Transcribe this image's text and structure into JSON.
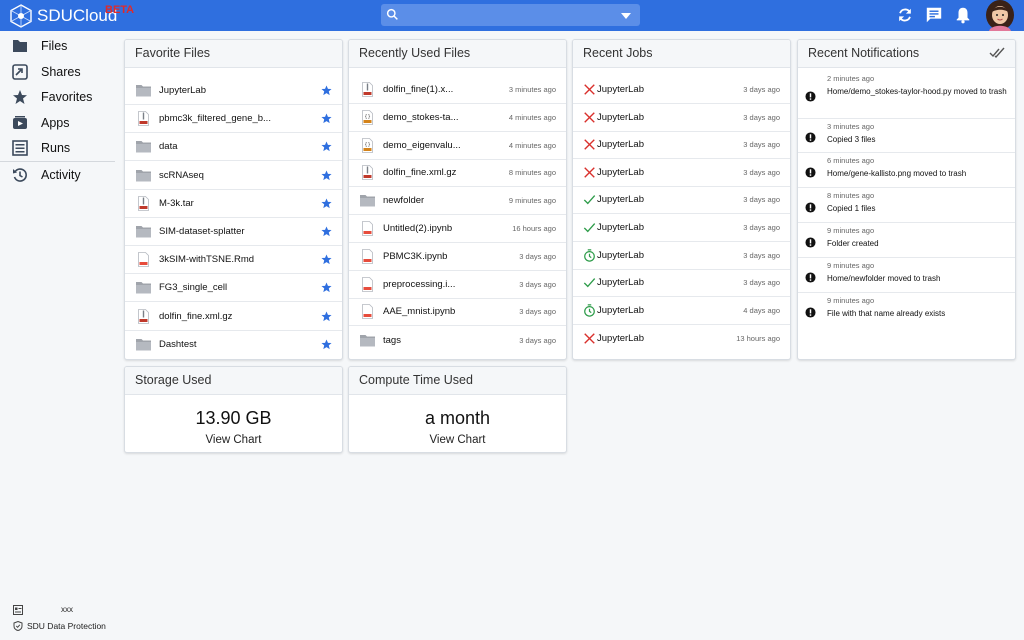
{
  "app": {
    "name": "SDUCloud",
    "badge": "BETA"
  },
  "header": {
    "search_placeholder": "",
    "icons": [
      "refresh-icon",
      "chat-icon",
      "bell-icon"
    ]
  },
  "sidebar": {
    "items": [
      {
        "label": "Files",
        "icon": "folder-icon"
      },
      {
        "label": "Shares",
        "icon": "share-icon"
      },
      {
        "label": "Favorites",
        "icon": "star-icon"
      },
      {
        "label": "Apps",
        "icon": "apps-icon"
      },
      {
        "label": "Runs",
        "icon": "runs-icon"
      },
      {
        "label": "Activity",
        "icon": "history-icon"
      }
    ],
    "footer": {
      "user": "xxx",
      "protection_label": "SDU Data Protection"
    }
  },
  "favorites": {
    "title": "Favorite Files",
    "files": [
      {
        "name": "JupyterLab",
        "type": "folder"
      },
      {
        "name": "pbmc3k_filtered_gene_b...",
        "type": "tar"
      },
      {
        "name": "data",
        "type": "folder"
      },
      {
        "name": "scRNAseq",
        "type": "folder"
      },
      {
        "name": "M-3k.tar",
        "type": "tar"
      },
      {
        "name": "SIM-dataset-splatter",
        "type": "folder"
      },
      {
        "name": "3kSIM-withTSNE.Rmd",
        "type": "rmd"
      },
      {
        "name": "FG3_single_cell",
        "type": "folder"
      },
      {
        "name": "dolfin_fine.xml.gz",
        "type": "gz"
      },
      {
        "name": "Dashtest",
        "type": "folder"
      }
    ]
  },
  "recent_files": {
    "title": "Recently Used Files",
    "files": [
      {
        "name": "dolfin_fine(1).x...",
        "type": "gz",
        "time": "3 minutes ago"
      },
      {
        "name": "demo_stokes-ta...",
        "type": "py",
        "time": "4 minutes ago"
      },
      {
        "name": "demo_eigenvalu...",
        "type": "py",
        "time": "4 minutes ago"
      },
      {
        "name": "dolfin_fine.xml.gz",
        "type": "gz",
        "time": "8 minutes ago"
      },
      {
        "name": "newfolder",
        "type": "folder",
        "time": "9 minutes ago"
      },
      {
        "name": "Untitled(2).ipynb",
        "type": "ipynb",
        "time": "16 hours ago"
      },
      {
        "name": "PBMC3K.ipynb",
        "type": "ipynb",
        "time": "3 days ago"
      },
      {
        "name": "preprocessing.i...",
        "type": "ipynb",
        "time": "3 days ago"
      },
      {
        "name": "AAE_mnist.ipynb",
        "type": "ipynb",
        "time": "3 days ago"
      },
      {
        "name": "tags",
        "type": "folder",
        "time": "3 days ago"
      }
    ]
  },
  "recent_jobs": {
    "title": "Recent Jobs",
    "jobs": [
      {
        "name": "JupyterLab",
        "status": "failed",
        "time": "3 days ago"
      },
      {
        "name": "JupyterLab",
        "status": "failed",
        "time": "3 days ago"
      },
      {
        "name": "JupyterLab",
        "status": "failed",
        "time": "3 days ago"
      },
      {
        "name": "JupyterLab",
        "status": "failed",
        "time": "3 days ago"
      },
      {
        "name": "JupyterLab",
        "status": "success",
        "time": "3 days ago"
      },
      {
        "name": "JupyterLab",
        "status": "success",
        "time": "3 days ago"
      },
      {
        "name": "JupyterLab",
        "status": "timeout",
        "time": "3 days ago"
      },
      {
        "name": "JupyterLab",
        "status": "success",
        "time": "3 days ago"
      },
      {
        "name": "JupyterLab",
        "status": "timeout",
        "time": "4 days ago"
      },
      {
        "name": "JupyterLab",
        "status": "failed",
        "time": "13 hours ago"
      }
    ]
  },
  "notifications": {
    "title": "Recent Notifications",
    "items": [
      {
        "time": "2 minutes ago",
        "text": "Home/demo_stokes-taylor-hood.py moved to trash"
      },
      {
        "time": "3 minutes ago",
        "text": "Copied 3 files"
      },
      {
        "time": "6 minutes ago",
        "text": "Home/gene-kallisto.png moved to trash"
      },
      {
        "time": "8 minutes ago",
        "text": "Copied 1 files"
      },
      {
        "time": "9 minutes ago",
        "text": "Folder created"
      },
      {
        "time": "9 minutes ago",
        "text": "Home/newfolder moved to trash"
      },
      {
        "time": "9 minutes ago",
        "text": "File with that name already exists"
      }
    ]
  },
  "storage": {
    "title": "Storage Used",
    "value": "13.90 GB",
    "link": "View Chart"
  },
  "compute": {
    "title": "Compute Time Used",
    "value": "a month",
    "link": "View Chart"
  },
  "colors": {
    "header": "#2f6fdf",
    "star": "#2f6fdf",
    "failed": "#d9302c",
    "success": "#2e9c4a",
    "background": "#f5f7f9"
  }
}
